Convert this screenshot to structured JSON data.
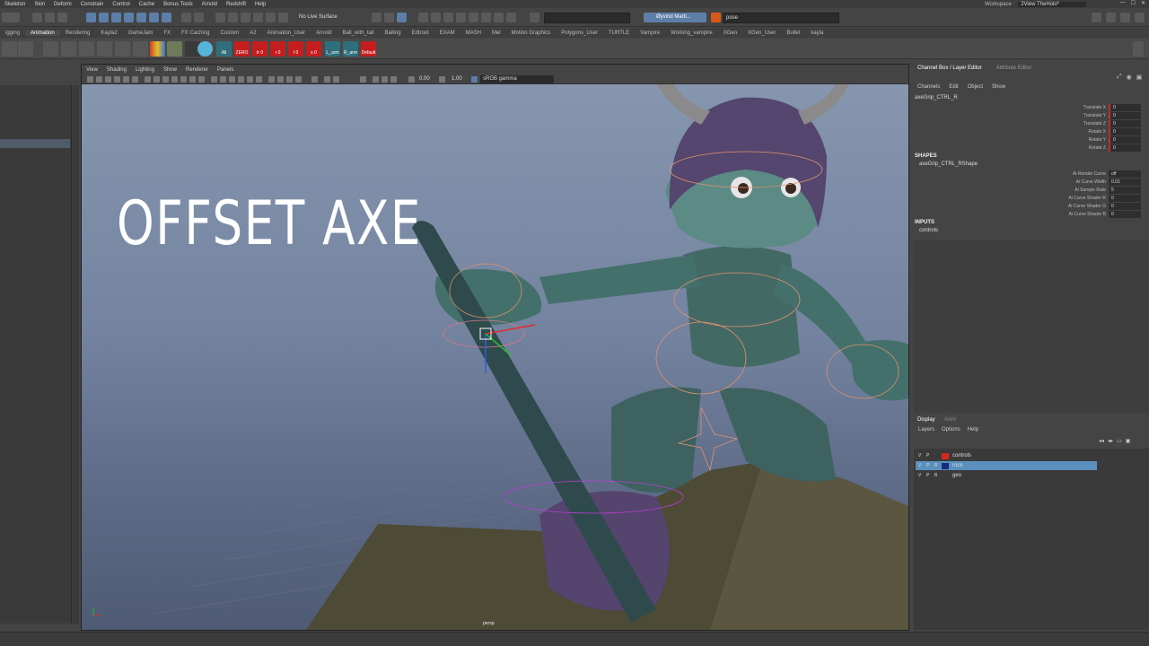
{
  "menubar": [
    "Skeleton",
    "Skin",
    "Deform",
    "Constrain",
    "Control",
    "Cache",
    "Bonus Tools",
    "Arnold",
    "Redshift",
    "Help"
  ],
  "workspace": {
    "label": "Workspace :",
    "value": "2View TheHolo*"
  },
  "statusline": {
    "live_surface": "No Live Surface",
    "user": "Øyvind Marti...",
    "search_value": "pose"
  },
  "shelf_tabs": [
    "igging",
    "Animation",
    "Rendering",
    "Kayla2",
    "GameJam",
    "FX",
    "FX Caching",
    "Custom",
    "A2",
    "Animation_User",
    "Arnold",
    "Ball_with_tail",
    "Bailing",
    "Edtrool",
    "EXAM",
    "MASH",
    "Mel",
    "Motion Graphics",
    "Polygons_User",
    "TURTLE",
    "Vampire",
    "Working_vampire",
    "XGen",
    "XGen_User",
    "Bullet",
    "kayla"
  ],
  "shelf_tabs_active": "Animation",
  "shelf_buttons": [
    "All",
    "ZERO",
    "tr 0",
    "r 0",
    "t 0",
    "s 0",
    "L_arm",
    "R_arm",
    "Default"
  ],
  "viewport": {
    "menu": [
      "View",
      "Shading",
      "Lighting",
      "Show",
      "Renderer",
      "Panels"
    ],
    "near": "0.00",
    "far": "1.00",
    "color_space": "sRGB gamma",
    "camera": "persp",
    "overlay_title": "OFFSET AXE"
  },
  "channel_box": {
    "tabs": [
      "Channel Box / Layer Editor",
      "Attribute Editor"
    ],
    "menu": [
      "Channels",
      "Edit",
      "Object",
      "Show"
    ],
    "object": "axeGrip_CTRL_R",
    "attributes": [
      {
        "name": "Translate X",
        "value": "0"
      },
      {
        "name": "Translate Y",
        "value": "0"
      },
      {
        "name": "Translate Z",
        "value": "0"
      },
      {
        "name": "Rotate X",
        "value": "0"
      },
      {
        "name": "Rotate Y",
        "value": "0"
      },
      {
        "name": "Rotate Z",
        "value": "0"
      }
    ],
    "shapes_title": "SHAPES",
    "shape_name": "axeGrip_CTRL_RShape",
    "shape_attributes": [
      {
        "name": "Ai Render Curve",
        "value": "off"
      },
      {
        "name": "Ai Curve Width",
        "value": "0.01"
      },
      {
        "name": "Ai Sample Rate",
        "value": "5"
      },
      {
        "name": "Ai Curve Shader R",
        "value": "0"
      },
      {
        "name": "Ai Curve Shader G",
        "value": "0"
      },
      {
        "name": "Ai Curve Shader B",
        "value": "0"
      }
    ],
    "inputs_title": "INPUTS",
    "input_name": "controls"
  },
  "layer_editor": {
    "tabs": [
      "Display",
      "Anim"
    ],
    "menu": [
      "Layers",
      "Options",
      "Help"
    ],
    "layers": [
      {
        "v": "V",
        "p": "P",
        "r": "",
        "color": "#d42a1c",
        "name": "controls",
        "selected": false
      },
      {
        "v": "V",
        "p": "P",
        "r": "R",
        "color": "#1a2a7a",
        "name": "rock",
        "selected": true
      },
      {
        "v": "V",
        "p": "P",
        "r": "R",
        "color": "#3a3a3a",
        "name": "geo",
        "selected": false
      }
    ]
  }
}
